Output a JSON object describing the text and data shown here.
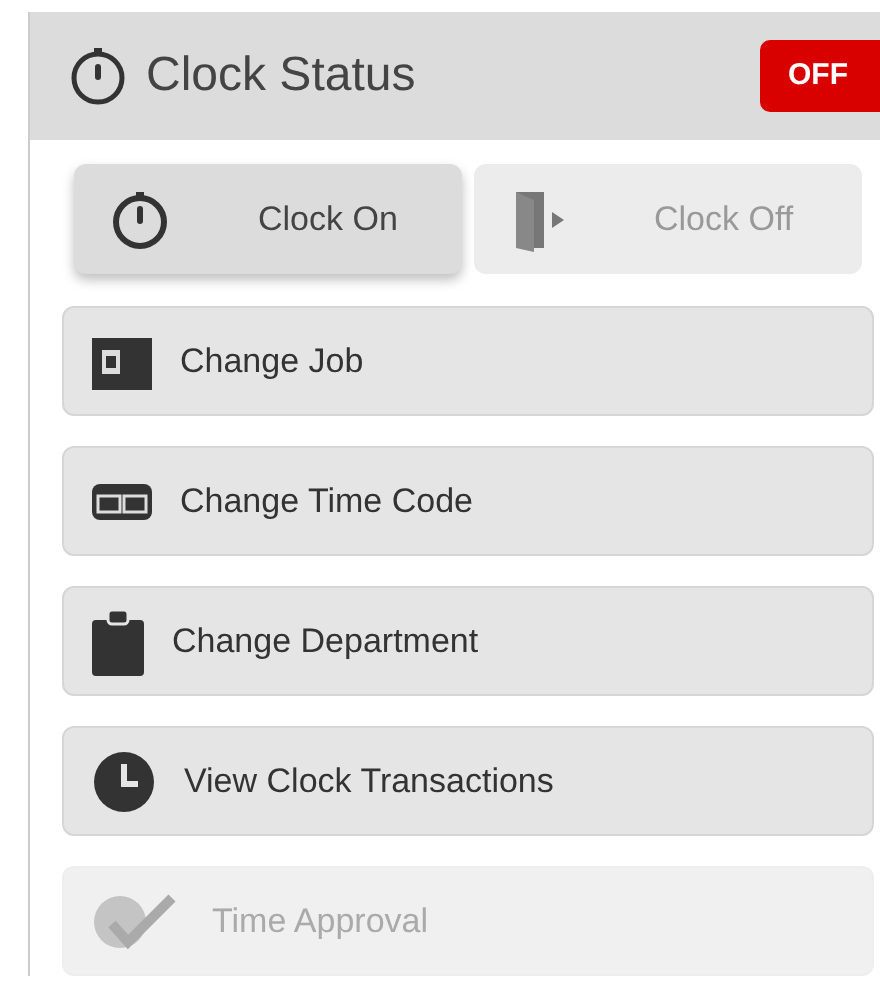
{
  "header": {
    "title": "Clock Status",
    "status_badge": "OFF"
  },
  "clock_buttons": [
    {
      "kind": "stopwatch",
      "label": "Clock On",
      "selected": true,
      "disabled": false
    },
    {
      "kind": "door",
      "label": "Clock Off",
      "selected": false,
      "disabled": true
    }
  ],
  "actions": [
    {
      "kind": "badge",
      "label": "Change Job",
      "disabled": false
    },
    {
      "kind": "card",
      "label": "Change Time Code",
      "disabled": false
    },
    {
      "kind": "clipboard",
      "label": "Change Department",
      "disabled": false
    },
    {
      "kind": "clock",
      "label": "View Clock Transactions",
      "disabled": false
    },
    {
      "kind": "approve",
      "label": "Time Approval",
      "disabled": true
    }
  ]
}
